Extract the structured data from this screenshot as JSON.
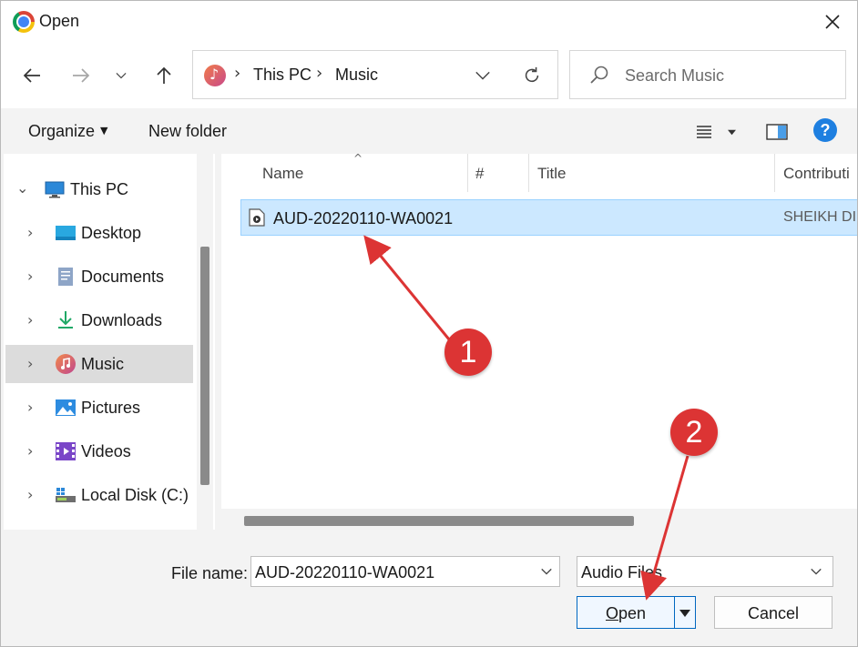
{
  "window": {
    "title": "Open"
  },
  "address": {
    "crumbs": [
      "This PC",
      "Music"
    ],
    "separator": "›"
  },
  "search": {
    "placeholder": "Search Music"
  },
  "toolbar": {
    "organize_label": "Organize",
    "new_folder_label": "New folder",
    "help_label": "?"
  },
  "sidebar": {
    "root": {
      "label": "This PC",
      "chevron": "⌄"
    },
    "items": [
      {
        "label": "Desktop",
        "chevron": "›",
        "icon": "desktop-icon"
      },
      {
        "label": "Documents",
        "chevron": "›",
        "icon": "documents-icon"
      },
      {
        "label": "Downloads",
        "chevron": "›",
        "icon": "downloads-icon"
      },
      {
        "label": "Music",
        "chevron": "›",
        "icon": "music-icon",
        "selected": true
      },
      {
        "label": "Pictures",
        "chevron": "›",
        "icon": "pictures-icon"
      },
      {
        "label": "Videos",
        "chevron": "›",
        "icon": "videos-icon"
      },
      {
        "label": "Local Disk (C:)",
        "chevron": "›",
        "icon": "drive-icon"
      }
    ]
  },
  "filelist": {
    "columns": [
      "Name",
      "#",
      "Title",
      "Contributi"
    ],
    "sort_indicator": "^",
    "files": [
      {
        "name": "AUD-20220110-WA0021",
        "contributing": "SHEIKH DI",
        "selected": true
      }
    ]
  },
  "bottom": {
    "filename_label": "File name:",
    "filename_value": "AUD-20220110-WA0021",
    "filetype_value": "Audio Files",
    "open_label": "Open",
    "cancel_label": "Cancel"
  },
  "annotations": [
    {
      "label": "1"
    },
    {
      "label": "2"
    }
  ],
  "colors": {
    "selection": "#cce8ff",
    "accent": "#0067c0",
    "annotation": "#dc3434"
  }
}
